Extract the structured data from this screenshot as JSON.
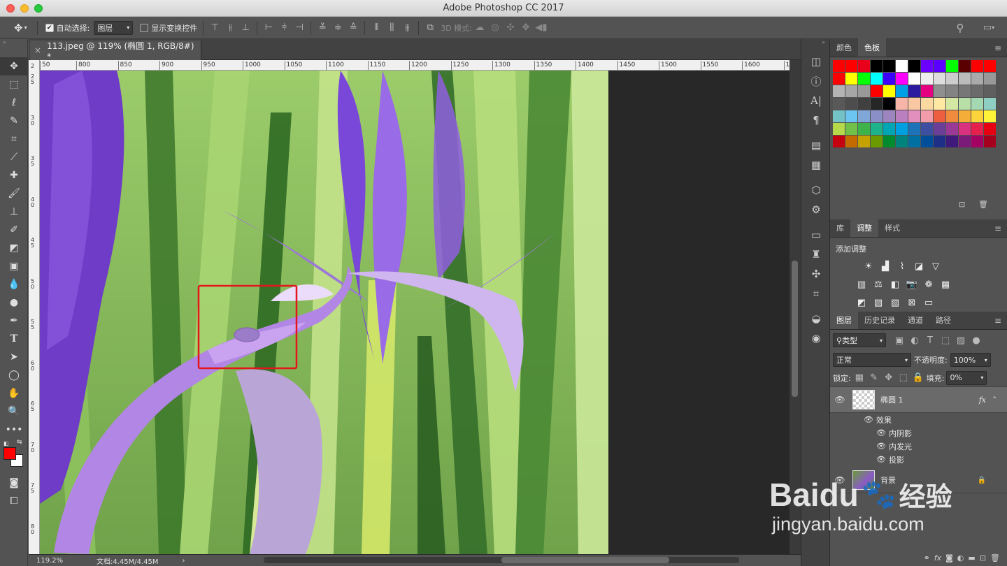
{
  "window": {
    "title": "Adobe Photoshop CC 2017"
  },
  "options_bar": {
    "auto_select_label": "自动选择:",
    "auto_select_checked": true,
    "auto_select_value": "图层",
    "show_transform_label": "显示变换控件",
    "show_transform_checked": false,
    "mode_3d_label": "3D 模式:"
  },
  "document": {
    "tab_title": "113.jpeg @ 119% (椭圆 1, RGB/8#) *",
    "ruler_ticks": [
      "50",
      "800",
      "850",
      "900",
      "950",
      "1000",
      "1050",
      "1100",
      "1150",
      "1200",
      "1250",
      "1300",
      "1350",
      "1400",
      "1450",
      "1500",
      "1550",
      "1600",
      "16"
    ],
    "vruler_ticks": [
      "2",
      "2\n5",
      "3\n0",
      "3\n5",
      "4\n0",
      "4\n5",
      "5\n0",
      "5\n5",
      "6\n0",
      "6\n5",
      "7\n0",
      "7\n5",
      "8\n0",
      "8\n5"
    ],
    "zoom": "119.2%",
    "doc_info": "文档:4.45M/4.45M"
  },
  "panels": {
    "color_tabs": [
      "颜色",
      "色板"
    ],
    "color_active": 1,
    "swatch_rows": [
      [
        "#ff0000",
        "#ff0000",
        "#e8001a",
        "#000000",
        "#000000",
        "#ffffff",
        "#000000",
        "#6b00ff",
        "#5b00ff",
        "#00ff00",
        "#5a0000",
        "#ff0000",
        "#ff0000"
      ],
      [
        "#ff0000",
        "#ffff00",
        "#00ff00",
        "#00ffff",
        "#3b00ff",
        "#ff00ff",
        "#ffffff",
        "#eeeeee",
        "#dddddd",
        "#cccccc",
        "#bbbbbb",
        "#aaaaaa",
        "#999999"
      ],
      [
        "#b3b3b3",
        "#a6a6a6",
        "#999999",
        "#ff0000",
        "#ffff00",
        "#00a0e9",
        "#2c1b9e",
        "#e4007f",
        "#8f8f8f",
        "#838383",
        "#777777",
        "#6b6b6b",
        "#5f5f5f"
      ],
      [
        "#595959",
        "#4d4d4d",
        "#404040",
        "#262626",
        "#000000",
        "#f7b4a8",
        "#f9c8a2",
        "#fbd9a0",
        "#ffe8a2",
        "#d4e8a4",
        "#b8dfa7",
        "#a4d8b3",
        "#8fcfc3"
      ],
      [
        "#73c3c6",
        "#6bc5f0",
        "#7fa7d8",
        "#8a8fc8",
        "#9d85c0",
        "#b97fbf",
        "#e38fbd",
        "#f29bab",
        "#ec5e3f",
        "#f08a3c",
        "#f5ad3a",
        "#fbd33a",
        "#fff33a"
      ],
      [
        "#b6d94a",
        "#71c048",
        "#3eb34a",
        "#1eb28a",
        "#00a6b4",
        "#00a0e0",
        "#1d72b8",
        "#3e4fa1",
        "#6b3e98",
        "#9a3a96",
        "#d9317f",
        "#e6204c",
        "#e60012"
      ],
      [
        "#c5000f",
        "#c46a00",
        "#c4a200",
        "#6b9a00",
        "#008c2e",
        "#00837d",
        "#006fa2",
        "#004e9a",
        "#1d2f86",
        "#3f1a7a",
        "#7b1a78",
        "#a50064",
        "#a6001f"
      ]
    ],
    "adj_tabs": [
      "库",
      "调整",
      "样式"
    ],
    "adj_active": 1,
    "adj_title": "添加调整",
    "layers_tabs": [
      "图层",
      "历史记录",
      "通道",
      "路径"
    ],
    "layers_active": 0,
    "filter_kind": "类型",
    "blend_mode": "正常",
    "opacity_label": "不透明度:",
    "opacity_value": "100%",
    "lock_label": "锁定:",
    "fill_label": "填充:",
    "fill_value": "0%",
    "layers": [
      {
        "name": "椭圆 1",
        "fx": "fx",
        "effects_label": "效果",
        "effects": [
          "内阴影",
          "内发光",
          "投影"
        ]
      },
      {
        "name": "背景"
      }
    ]
  },
  "watermark": {
    "brand": "Baidu",
    "brand_cn": "经验",
    "url": "jingyan.baidu.com"
  }
}
